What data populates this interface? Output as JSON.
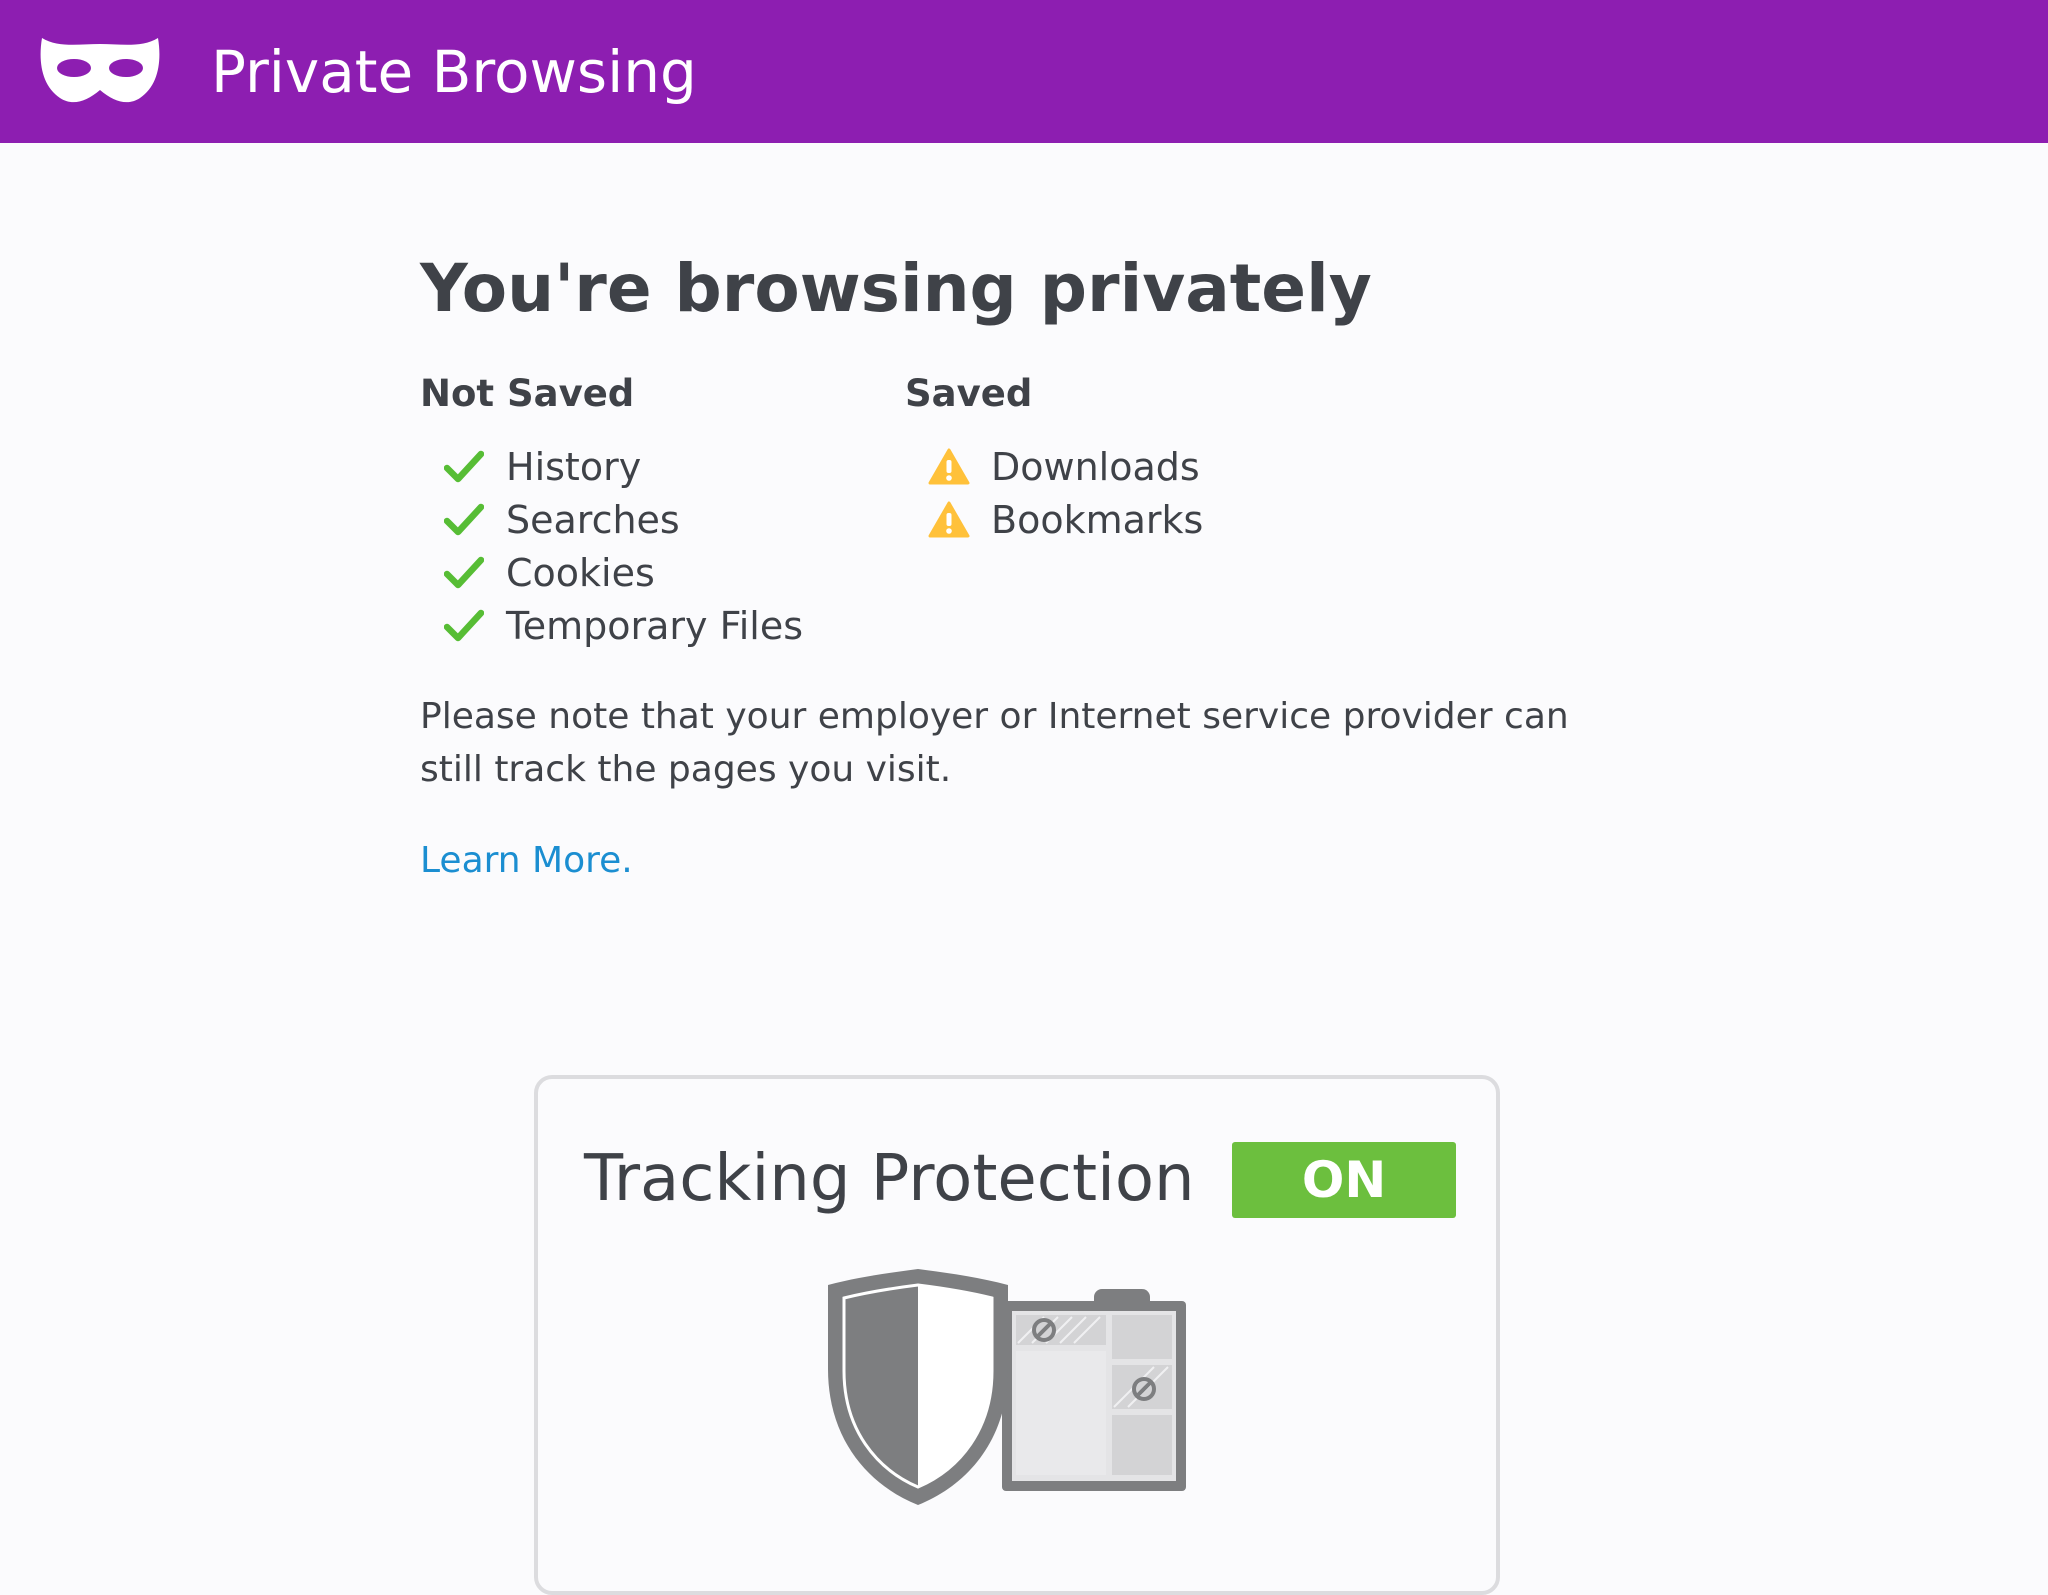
{
  "header": {
    "title": "Private Browsing",
    "background": "#8d1eb1",
    "icon": "mask-icon"
  },
  "main": {
    "headline": "You're browsing privately",
    "not_saved": {
      "heading": "Not Saved",
      "icon": "checkmark-icon",
      "icon_color": "#57bd35",
      "items": [
        "History",
        "Searches",
        "Cookies",
        "Temporary Files"
      ]
    },
    "saved": {
      "heading": "Saved",
      "icon": "warning-icon",
      "icon_color": "#ffc13a",
      "items": [
        "Downloads",
        "Bookmarks"
      ]
    },
    "note": "Please note that your employer or Internet service provider can still track the pages you visit.",
    "learn_more": "Learn More.",
    "link_color": "#1b8ed1"
  },
  "tracking_protection": {
    "title": "Tracking Protection",
    "toggle_label": "ON",
    "toggle_color": "#6cbf3e",
    "illustration_icon": "shield-icon"
  }
}
